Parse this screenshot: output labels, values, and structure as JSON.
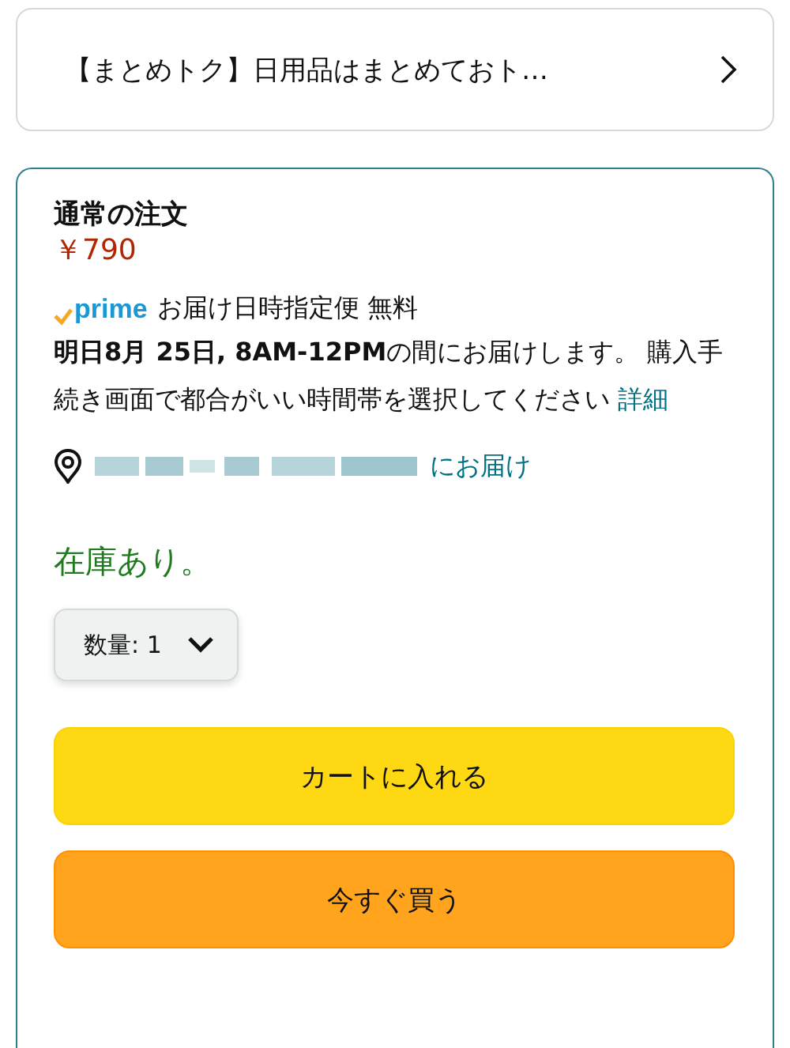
{
  "promo_banner": {
    "text": "【まとめトク】日用品はまとめておト…"
  },
  "order": {
    "title": "通常の注文",
    "price": "￥790",
    "prime": {
      "logo": "prime",
      "service": "お届け日時指定便 無料"
    },
    "delivery_text": "**明日8月 25日, 8AM-12PM**の間にお届けします。 購入手続き画面で都合がいい時間帯を選択してください",
    "details_link": "詳細",
    "deliver_to": "にお届け",
    "stock": "在庫あり。",
    "quantity": {
      "label": "数量:",
      "value": "1"
    },
    "buttons": [
      {
        "kind": "cart",
        "label": "カートに入れる"
      },
      {
        "kind": "buy",
        "label": "今すぐ買う"
      }
    ]
  }
}
